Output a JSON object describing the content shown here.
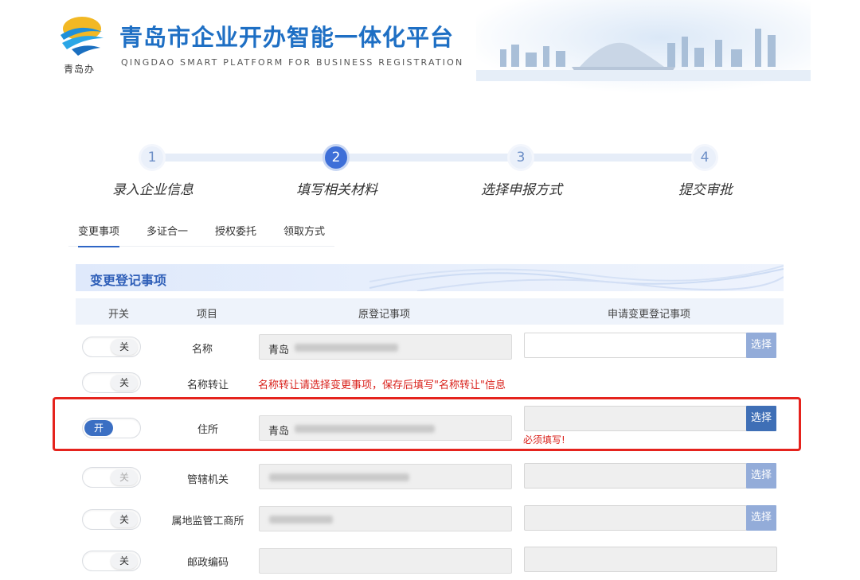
{
  "header": {
    "logo_text": "青岛办",
    "title": "青岛市企业开办智能一体化平台",
    "subtitle": "QINGDAO SMART PLATFORM FOR BUSINESS REGISTRATION"
  },
  "steps": [
    {
      "number": "1",
      "label": "录入企业信息",
      "state": "done"
    },
    {
      "number": "2",
      "label": "填写相关材料",
      "state": "active"
    },
    {
      "number": "3",
      "label": "选择申报方式",
      "state": "pending"
    },
    {
      "number": "4",
      "label": "提交审批",
      "state": "pending"
    }
  ],
  "tabs": [
    {
      "label": "变更事项",
      "active": true
    },
    {
      "label": "多证合一",
      "active": false
    },
    {
      "label": "授权委托",
      "active": false
    },
    {
      "label": "领取方式",
      "active": false
    }
  ],
  "section": {
    "title": "变更登记事项"
  },
  "columns": {
    "switch": "开关",
    "item": "项目",
    "original": "原登记事项",
    "requested": "申请变更登记事项"
  },
  "toggle_labels": {
    "on": "开",
    "off": "关"
  },
  "select_label": "选择",
  "rows": [
    {
      "item": "名称",
      "toggle": "关",
      "original_prefix": "青岛"
    },
    {
      "item": "名称转让",
      "toggle": "关",
      "notice": "名称转让请选择变更事项，保存后填写\"名称转让\"信息"
    },
    {
      "item": "住所",
      "toggle": "开",
      "original_prefix": "青岛",
      "validation": "必须填写!"
    },
    {
      "item": "管辖机关",
      "toggle": "关"
    },
    {
      "item": "属地监管工商所",
      "toggle": "关"
    },
    {
      "item": "邮政编码",
      "toggle": "关"
    }
  ],
  "colors": {
    "accent": "#3e6fd8",
    "brand_title": "#1e6fc4",
    "error": "#d9201a",
    "highlight": "#e5231d"
  }
}
